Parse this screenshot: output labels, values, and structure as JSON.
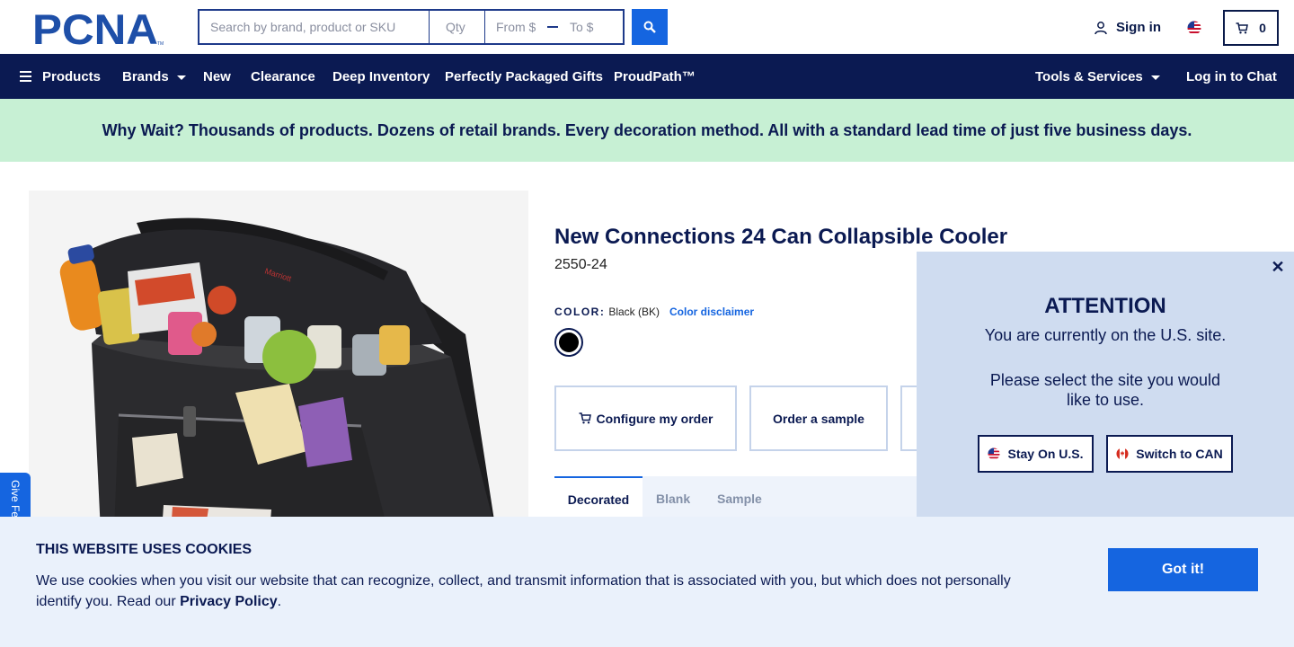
{
  "brand": {
    "logo_text": "PCNA",
    "trademark": "TM"
  },
  "search": {
    "term_placeholder": "Search by brand, product or SKU",
    "qty_placeholder": "Qty",
    "from_placeholder": "From $",
    "to_placeholder": "To $"
  },
  "header": {
    "signin_label": "Sign in",
    "cart_count": "0"
  },
  "nav": {
    "items": [
      "Products",
      "Brands",
      "New",
      "Clearance",
      "Deep Inventory",
      "Perfectly Packaged Gifts",
      "ProudPath™"
    ],
    "tools_label": "Tools & Services",
    "chat_label": "Log in to Chat"
  },
  "promo": {
    "text": "Why Wait? Thousands of products. Dozens of retail brands. Every decoration method. All with a standard lead time of just five business days."
  },
  "product": {
    "title": "New Connections 24 Can Collapsible Cooler",
    "sku": "2550-24",
    "color_label": "COLOR:",
    "color_value": "Black (BK)",
    "color_disclaimer": "Color disclaimer",
    "swatch_color": "#000000",
    "image_imprint": "Marriott"
  },
  "actions": {
    "configure_label": "Configure my order",
    "sample_label": "Order a sample"
  },
  "tabs": [
    "Decorated",
    "Blank",
    "Sample"
  ],
  "feedback": {
    "label": "Give Feedback"
  },
  "locale_modal": {
    "title": "ATTENTION",
    "line1": "You are currently on the U.S. site.",
    "line2": "Please select the site you would like to use.",
    "stay_label": "Stay On U.S.",
    "switch_label": "Switch to CAN"
  },
  "cookie": {
    "title": "THIS WEBSITE USES COOKIES",
    "text": "We use cookies when you visit our website that can recognize, collect, and transmit information that is associated with you, but which does not personally identify you. Read our",
    "policy_link": "Privacy Policy",
    "period": ".",
    "accept_label": "Got it!"
  },
  "colors": {
    "navy": "#0b1a52",
    "accent_blue": "#1565e0",
    "promo_green": "#c7f0d4",
    "modal_bg": "#cfdcf0",
    "cookie_bg": "#eaf1fb"
  }
}
